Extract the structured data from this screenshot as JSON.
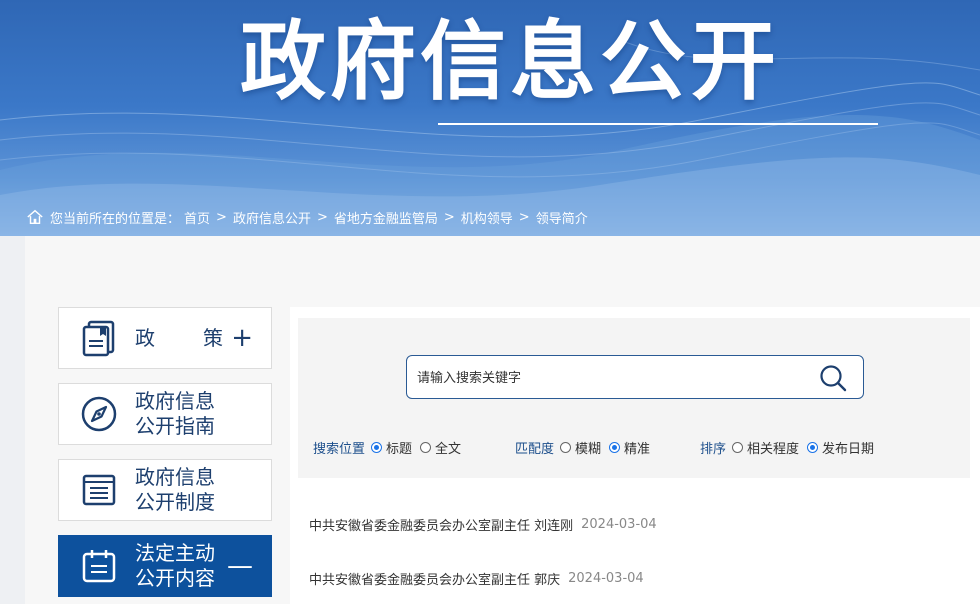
{
  "banner": {
    "title": "政府信息公开"
  },
  "breadcrumb": {
    "prefix": "您当前所在的位置是：",
    "items": [
      "首页",
      "政府信息公开",
      "省地方金融监管局",
      "机构领导",
      "领导简介"
    ],
    "separator": ">"
  },
  "sidebar": {
    "items": [
      {
        "line1": "政",
        "line2": "策",
        "toggle": "+"
      },
      {
        "line1": "政府信息",
        "line2": "公开指南"
      },
      {
        "line1": "政府信息",
        "line2": "公开制度"
      },
      {
        "line1": "法定主动",
        "line2": "公开内容",
        "toggle": "—"
      }
    ],
    "active_color": "#0d519d"
  },
  "search": {
    "placeholder": "请输入搜索关键字",
    "position": {
      "label": "搜索位置",
      "options": [
        "标题",
        "全文"
      ],
      "selected": "标题"
    },
    "match": {
      "label": "匹配度",
      "options": [
        "模糊",
        "精准"
      ],
      "selected": "精准"
    },
    "sort": {
      "label": "排序",
      "options": [
        "相关程度",
        "发布日期"
      ],
      "selected": "发布日期"
    }
  },
  "results": [
    {
      "title": "中共安徽省委金融委员会办公室副主任 刘连刚",
      "date": "2024-03-04"
    },
    {
      "title": "中共安徽省委金融委员会办公室副主任 郭庆",
      "date": "2024-03-04"
    }
  ]
}
